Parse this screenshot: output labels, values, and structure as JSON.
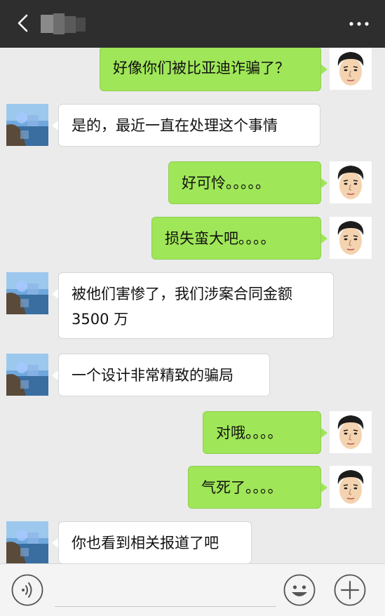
{
  "header": {
    "title": "",
    "back_icon": "back-chevron-icon",
    "more_icon": "more-dots-icon"
  },
  "messages": [
    {
      "side": "right",
      "text": "好像你们被比亚迪诈骗了？"
    },
    {
      "side": "left",
      "text": "是的，最近一直在处理这个事情"
    },
    {
      "side": "right",
      "text": "好可怜。。。。。"
    },
    {
      "side": "right",
      "text": "损失蛮大吧。。。。"
    },
    {
      "side": "left",
      "text": "被他们害惨了，我们涉案合同金额",
      "text2": "3500 万"
    },
    {
      "side": "left",
      "text": "一个设计非常精致的骗局"
    },
    {
      "side": "right",
      "text": "对哦。。。。"
    },
    {
      "side": "right",
      "text": "气死了。。。。"
    },
    {
      "side": "left",
      "text": "你也看到相关报道了吧"
    }
  ],
  "input": {
    "placeholder": "",
    "voice_icon": "voice-icon",
    "emoji_icon": "emoji-icon",
    "plus_icon": "plus-icon"
  },
  "colors": {
    "topbar": "#2e2e2e",
    "background": "#ebebeb",
    "my_bubble": "#9fe658",
    "their_bubble": "#ffffff"
  }
}
